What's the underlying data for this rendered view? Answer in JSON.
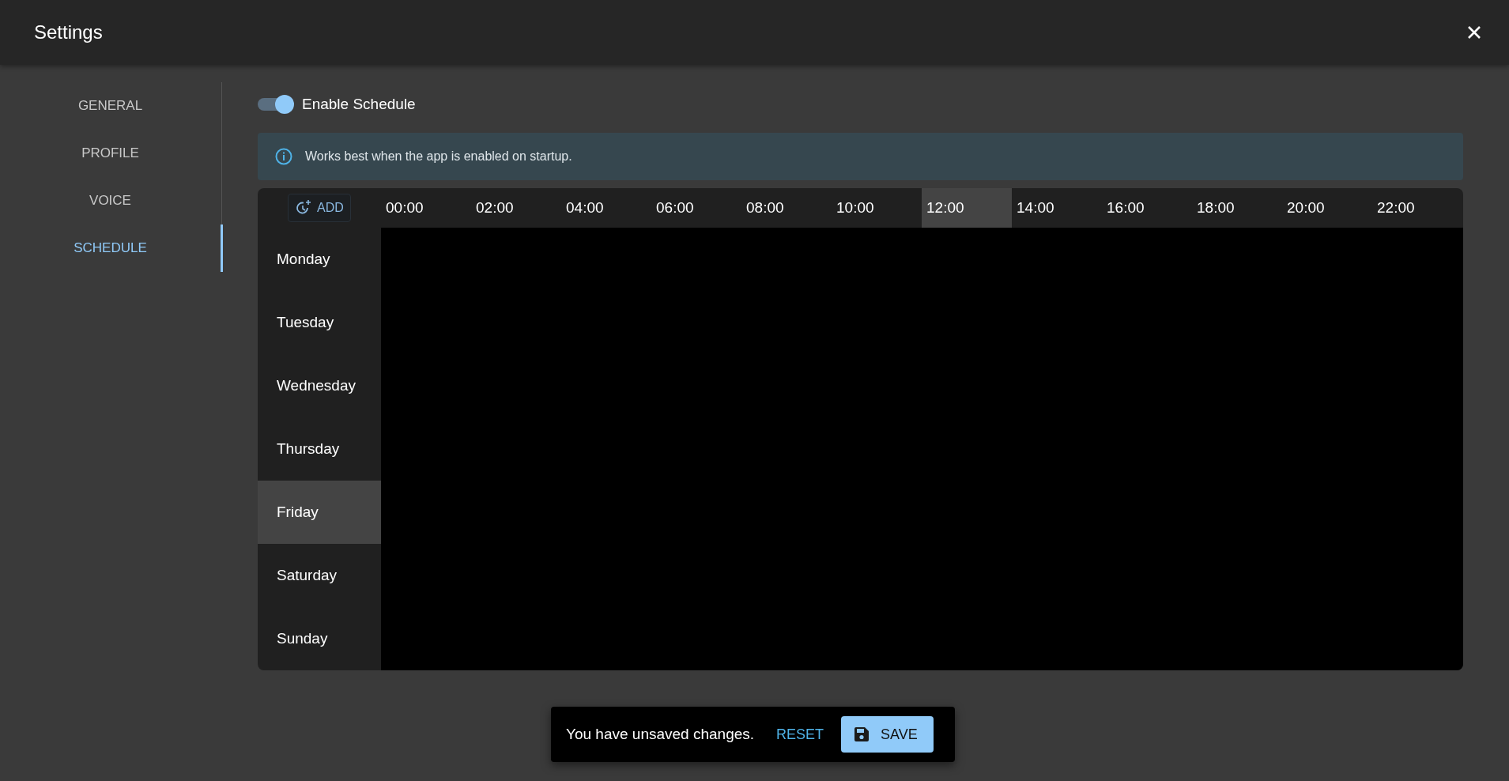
{
  "window": {
    "title": "Settings"
  },
  "sidebar": {
    "items": [
      {
        "label": "GENERAL",
        "selected": false
      },
      {
        "label": "PROFILE",
        "selected": false
      },
      {
        "label": "VOICE",
        "selected": false
      },
      {
        "label": "SCHEDULE",
        "selected": true
      }
    ]
  },
  "enable_schedule": {
    "label": "Enable Schedule",
    "on": true
  },
  "info_banner": {
    "text": "Works best when the app is enabled on startup."
  },
  "schedule": {
    "add_button": "ADD",
    "hours": [
      {
        "label": "00:00",
        "highlighted": false
      },
      {
        "label": "02:00",
        "highlighted": false
      },
      {
        "label": "04:00",
        "highlighted": false
      },
      {
        "label": "06:00",
        "highlighted": false
      },
      {
        "label": "08:00",
        "highlighted": false
      },
      {
        "label": "10:00",
        "highlighted": false
      },
      {
        "label": "12:00",
        "highlighted": true
      },
      {
        "label": "14:00",
        "highlighted": false
      },
      {
        "label": "16:00",
        "highlighted": false
      },
      {
        "label": "18:00",
        "highlighted": false
      },
      {
        "label": "20:00",
        "highlighted": false
      },
      {
        "label": "22:00",
        "highlighted": false
      }
    ],
    "days": [
      {
        "label": "Monday",
        "highlighted": false
      },
      {
        "label": "Tuesday",
        "highlighted": false
      },
      {
        "label": "Wednesday",
        "highlighted": false
      },
      {
        "label": "Thursday",
        "highlighted": false
      },
      {
        "label": "Friday",
        "highlighted": true
      },
      {
        "label": "Saturday",
        "highlighted": false
      },
      {
        "label": "Sunday",
        "highlighted": false
      }
    ]
  },
  "snackbar": {
    "message": "You have unsaved changes.",
    "reset_button": "RESET",
    "save_button": "SAVE"
  }
}
